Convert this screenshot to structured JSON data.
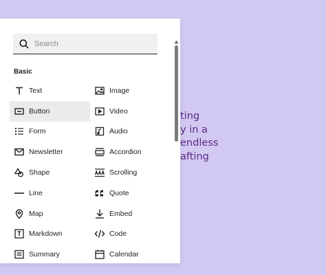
{
  "background": {
    "lines": [
      "ting",
      "y in a",
      "endless",
      "afting"
    ],
    "color": "#5b2a86",
    "page_color": "#d2c9f2"
  },
  "inserter": {
    "search": {
      "placeholder": "Search",
      "value": ""
    },
    "section_title": "Basic",
    "blocks": [
      {
        "label": "Text",
        "icon": "text-icon",
        "selected": false
      },
      {
        "label": "Image",
        "icon": "image-icon",
        "selected": false
      },
      {
        "label": "Button",
        "icon": "button-icon",
        "selected": true
      },
      {
        "label": "Video",
        "icon": "video-icon",
        "selected": false
      },
      {
        "label": "Form",
        "icon": "form-icon",
        "selected": false
      },
      {
        "label": "Audio",
        "icon": "audio-icon",
        "selected": false
      },
      {
        "label": "Newsletter",
        "icon": "envelope-icon",
        "selected": false
      },
      {
        "label": "Accordion",
        "icon": "accordion-icon",
        "selected": false
      },
      {
        "label": "Shape",
        "icon": "shape-icon",
        "selected": false
      },
      {
        "label": "Scrolling",
        "icon": "scrolling-icon",
        "selected": false
      },
      {
        "label": "Line",
        "icon": "line-icon",
        "selected": false
      },
      {
        "label": "Quote",
        "icon": "quote-icon",
        "selected": false
      },
      {
        "label": "Map",
        "icon": "map-pin-icon",
        "selected": false
      },
      {
        "label": "Embed",
        "icon": "embed-icon",
        "selected": false
      },
      {
        "label": "Markdown",
        "icon": "markdown-icon",
        "selected": false
      },
      {
        "label": "Code",
        "icon": "code-icon",
        "selected": false
      },
      {
        "label": "Summary",
        "icon": "summary-icon",
        "selected": false
      },
      {
        "label": "Calendar",
        "icon": "calendar-icon",
        "selected": false
      }
    ],
    "selected_color": "#ebebeb"
  }
}
